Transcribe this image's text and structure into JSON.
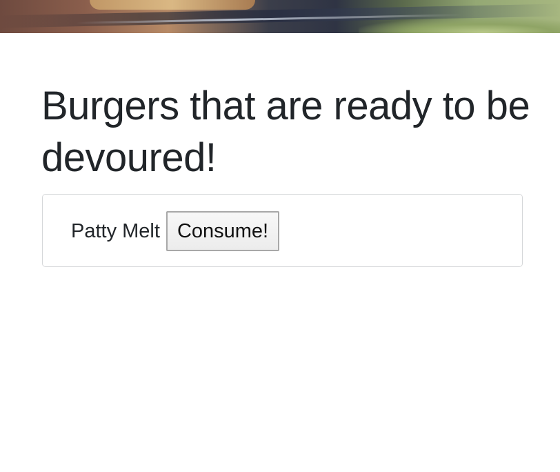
{
  "hero": {
    "image_name": "burger-photo"
  },
  "page": {
    "title": "Burgers that are ready to be devoured!"
  },
  "burgers": [
    {
      "name": "Patty Melt",
      "button_label": "Consume!"
    }
  ]
}
